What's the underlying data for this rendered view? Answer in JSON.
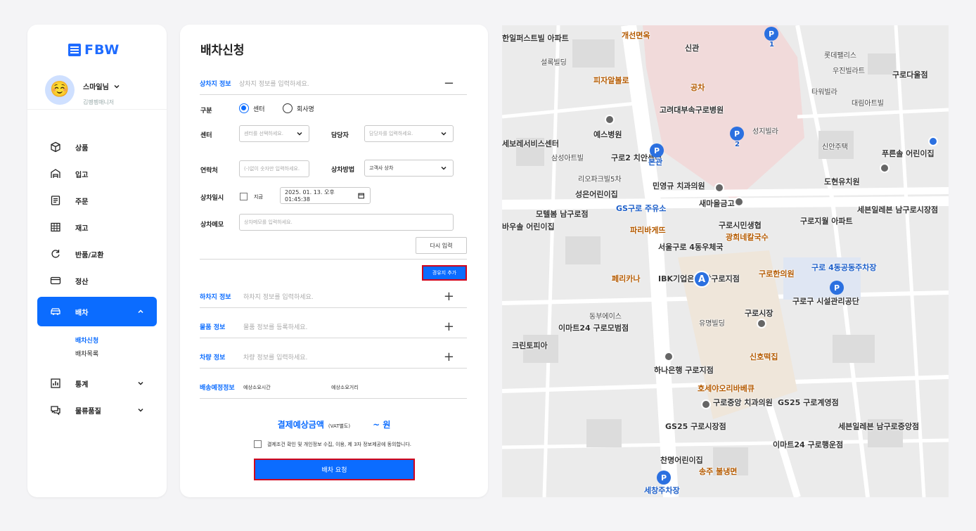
{
  "brand": {
    "logo_text": "FBW"
  },
  "user": {
    "name": "스마일님",
    "role": "김펭펭매니저",
    "avatar_emoji": "☺️"
  },
  "sidebar": {
    "items": [
      {
        "label": "상품",
        "icon": "box-icon"
      },
      {
        "label": "입고",
        "icon": "warehouse-icon"
      },
      {
        "label": "주문",
        "icon": "order-list-icon"
      },
      {
        "label": "재고",
        "icon": "grid-icon"
      },
      {
        "label": "반품/교환",
        "icon": "return-icon"
      },
      {
        "label": "정산",
        "icon": "card-icon"
      },
      {
        "label": "배차",
        "icon": "truck-icon"
      },
      {
        "label": "통계",
        "icon": "chart-icon"
      },
      {
        "label": "물류품질",
        "icon": "chat-icon"
      }
    ],
    "sub_items": [
      "배차신청",
      "배차목록"
    ]
  },
  "form": {
    "title": "배차신청",
    "pickup": {
      "label": "상차지 정보",
      "placeholder": "상차지 정보를 입력하세요.",
      "toggle": "−"
    },
    "type": {
      "label": "구분",
      "options": [
        "센터",
        "회사명"
      ],
      "selected": "센터"
    },
    "center": {
      "label": "센터",
      "placeholder": "센터를 선택하세요."
    },
    "manager": {
      "label": "담당자",
      "placeholder": "담당자를 입력하세요."
    },
    "contact": {
      "label": "연락처",
      "placeholder": "(-)없이 숫자만 입력하세요."
    },
    "load_method": {
      "label": "상차방법",
      "value": "고객사 상차"
    },
    "datetime": {
      "label": "상차일시",
      "now_label": "지금",
      "value": "2025. 01. 13. 오후 01:45:38"
    },
    "memo": {
      "label": "상차메모",
      "placeholder": "상차메모를 입력하세요."
    },
    "reset_button": "다시 입력",
    "add_stop_button": "경유지 추가",
    "dropoff": {
      "label": "하차지 정보",
      "placeholder": "하차지 정보를 입력하세요.",
      "toggle": "+"
    },
    "goods": {
      "label": "물품 정보",
      "placeholder": "물품 정보를 등록하세요.",
      "toggle": "+"
    },
    "vehicle": {
      "label": "차량 정보",
      "placeholder": "차량 정보를 입력하세요.",
      "toggle": "+"
    },
    "delivery": {
      "label": "배송예정정보",
      "time_label": "예상소요시간",
      "distance_label": "예상소요거리"
    },
    "estimate": {
      "title": "결제예상금액",
      "vat": "(VAT별도)",
      "value": "~ 원"
    },
    "agree_text": "결제조건 확인 및 개인정보 수집, 이용, 제 3자 정보제공에 동의합니다.",
    "submit_button": "배차 요청"
  },
  "map": {
    "labels": [
      "한일퍼스트빌 아파트",
      "설록빌딩",
      "피자알볼로",
      "개선면옥",
      "신관",
      "공차",
      "고려대부속구로병원",
      "예스병원",
      "세보레서비스센터",
      "삼성아트빌",
      "구로2 치안센터",
      "본관",
      "성지빌라",
      "신안주택",
      "푸른솔 어린이집",
      "리오파크빌5차",
      "성은어린이집",
      "민영규 치과의원",
      "GS구로 주유소",
      "새마을금고",
      "도현유치원",
      "세븐일레븐 남구로시장점",
      "모텔봄 남구로점",
      "파리바게뜨",
      "광희네칼국수",
      "구로시민생협",
      "구로지월 아파트",
      "서울구로 4동우체국",
      "IBK기업은행 남구로지점",
      "페리카나",
      "구로한의원",
      "구로 4동공동주차장",
      "구로구 시설관리공단",
      "동부에이스",
      "이마트24 구로모범점",
      "유명빌딩",
      "구로시장",
      "신호떡집",
      "하나은행 구로지점",
      "호세야오리바베큐",
      "구로중앙 치과의원",
      "GS25 구로계영점",
      "GS25 구로시장점",
      "이마트24 구로행운점",
      "세븐일레븐 남구로중앙점",
      "찬명어린이집",
      "송주 불냉면",
      "세창주차장",
      "크린토피아",
      "바우솔 어린이집",
      "우진빌라트",
      "타워빌라",
      "대림아트빌",
      "구로다울점",
      "롯데팰리스"
    ],
    "pin": "A",
    "parking_labels": [
      "1",
      "2"
    ]
  }
}
